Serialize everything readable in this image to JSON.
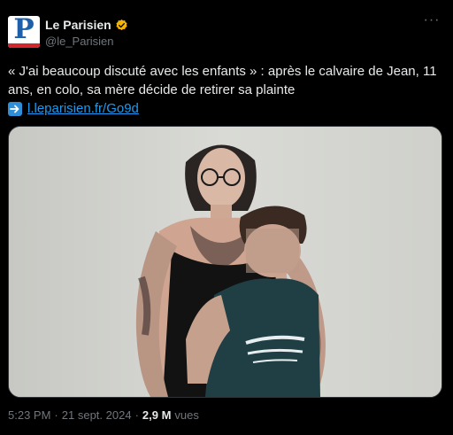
{
  "account": {
    "display_name": "Le Parisien",
    "handle": "@le_Parisien",
    "avatar_letter": "P",
    "verified": true,
    "verified_color": "#f4b400",
    "brand_blue": "#1d5fa8",
    "brand_red": "#d1262c"
  },
  "tweet": {
    "text": "« J'ai beaucoup discuté avec les enfants » : après le calvaire de Jean, 11 ans, en colo, sa mère décide de retirer sa plainte",
    "link_icon": "right-arrow-emoji",
    "link_text": "l.leparisien.fr/Go9d",
    "link_color": "#1d9bf0"
  },
  "meta": {
    "time": "5:23 PM",
    "separator": "·",
    "date": "21 sept. 2024",
    "views_count": "2,9 M",
    "views_label": "vues"
  },
  "media": {
    "alt_present": false
  }
}
